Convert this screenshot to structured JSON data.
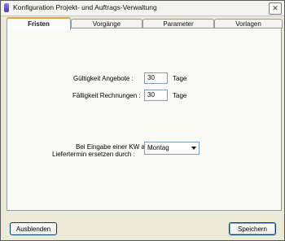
{
  "window": {
    "title": "Konfiguration Projekt- und Auftrags-Verwaltung",
    "close_symbol": "✕"
  },
  "tabs": [
    {
      "label": "Fristen",
      "active": true
    },
    {
      "label": "Vorgänge",
      "active": false
    },
    {
      "label": "Parameter",
      "active": false
    },
    {
      "label": "Vorlagen",
      "active": false
    }
  ],
  "form": {
    "gueltigkeit_label": "Gültigkeit Angebote :",
    "gueltigkeit_value": "30",
    "gueltigkeit_unit": "Tage",
    "faelligkeit_label": "Fälligkeit Rechnungen :",
    "faelligkeit_value": "30",
    "faelligkeit_unit": "Tage",
    "kw_label_line1": "Bei Eingabe einer KW als",
    "kw_label_line2": "Liefertermin ersetzen durch :",
    "kw_selected": "Montag"
  },
  "footer": {
    "hide_label": "Ausblenden",
    "save_label": "Speichern"
  }
}
